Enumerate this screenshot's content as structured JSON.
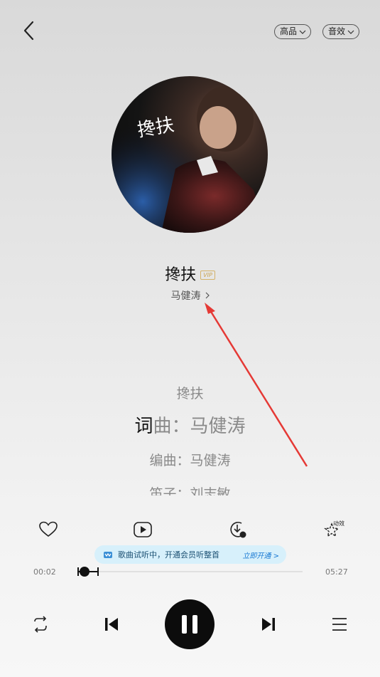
{
  "header": {
    "quality_label": "高品",
    "effect_label": "音效"
  },
  "song": {
    "title": "搀扶",
    "vip_badge": "VIP",
    "artist": "马健涛",
    "cover_text": "搀扶"
  },
  "lyrics": {
    "line1": "搀扶",
    "line2_highlight": "词",
    "line2_rest": "曲：马健涛",
    "line3": "编曲：马健涛",
    "line4": "笛子：刘志敏"
  },
  "actions": {
    "like": "heart-icon",
    "video": "video-play-icon",
    "download": "download-icon",
    "effect_label": "动效"
  },
  "trial_banner": {
    "text": "歌曲试听中，开通会员听整首",
    "cta": "立即开通 >"
  },
  "progress": {
    "current": "00:02",
    "total": "05:27",
    "played_fraction": 0.0061
  },
  "colors": {
    "annotation_arrow": "#e53935",
    "banner_bg": "#d7f0fb",
    "vip_gold": "#c9a24d"
  }
}
